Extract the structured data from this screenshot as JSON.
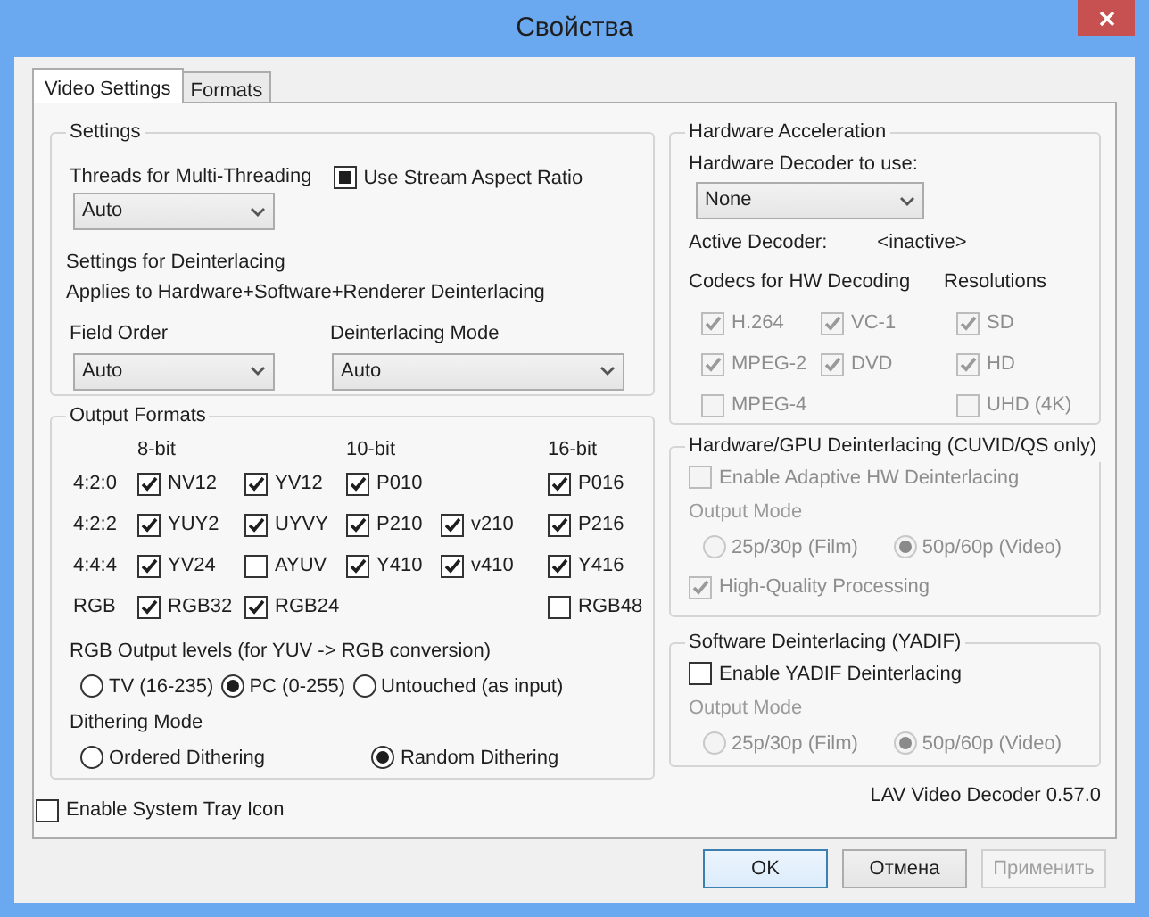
{
  "window": {
    "title": "Свойства"
  },
  "tabs": [
    {
      "label": "Video Settings",
      "selected": true
    },
    {
      "label": "Formats",
      "selected": false
    }
  ],
  "settings": {
    "title": "Settings",
    "threads": {
      "label": "Threads for Multi-Threading",
      "value": "Auto"
    },
    "stream_aspect_ratio": {
      "label": "Use Stream Aspect Ratio",
      "checked": false,
      "indeterminate": true
    },
    "deinterlacing_heading": "Settings for Deinterlacing",
    "deinterlacing_note": "Applies to Hardware+Software+Renderer Deinterlacing",
    "field_order": {
      "label": "Field Order",
      "value": "Auto"
    },
    "deinterlacing_mode": {
      "label": "Deinterlacing Mode",
      "value": "Auto"
    }
  },
  "output_formats": {
    "title": "Output Formats",
    "columns": {
      "bit_8": "8-bit",
      "bit_10": "10-bit",
      "bit_16": "16-bit"
    },
    "rows": [
      {
        "label": "4:2:0",
        "bit_8": [
          {
            "label": "NV12",
            "checked": true
          },
          {
            "label": "YV12",
            "checked": true
          }
        ],
        "bit_10": [
          {
            "label": "P010",
            "checked": true
          }
        ],
        "bit_16": [
          {
            "label": "P016",
            "checked": true
          }
        ]
      },
      {
        "label": "4:2:2",
        "bit_8": [
          {
            "label": "YUY2",
            "checked": true
          },
          {
            "label": "UYVY",
            "checked": true
          }
        ],
        "bit_10": [
          {
            "label": "P210",
            "checked": true
          },
          {
            "label": "v210",
            "checked": true
          }
        ],
        "bit_16": [
          {
            "label": "P216",
            "checked": true
          }
        ]
      },
      {
        "label": "4:4:4",
        "bit_8": [
          {
            "label": "YV24",
            "checked": true
          },
          {
            "label": "AYUV",
            "checked": false
          }
        ],
        "bit_10": [
          {
            "label": "Y410",
            "checked": true
          },
          {
            "label": "v410",
            "checked": true
          }
        ],
        "bit_16": [
          {
            "label": "Y416",
            "checked": true
          }
        ]
      },
      {
        "label": "RGB",
        "bit_8": [
          {
            "label": "RGB32",
            "checked": true
          },
          {
            "label": "RGB24",
            "checked": true
          }
        ],
        "bit_16": [
          {
            "label": "RGB48",
            "checked": false
          }
        ]
      }
    ],
    "rgb_levels": {
      "label": "RGB Output levels (for YUV -> RGB conversion)",
      "options": [
        {
          "label": "TV (16-235)",
          "selected": false
        },
        {
          "label": "PC (0-255)",
          "selected": true
        },
        {
          "label": "Untouched (as input)",
          "selected": false
        }
      ]
    },
    "dithering": {
      "label": "Dithering Mode",
      "options": [
        {
          "label": "Ordered Dithering",
          "selected": false
        },
        {
          "label": "Random Dithering",
          "selected": true
        }
      ]
    }
  },
  "system_tray": {
    "label": "Enable System Tray Icon",
    "checked": false
  },
  "hardware_acceleration": {
    "title": "Hardware Acceleration",
    "decoder_label": "Hardware Decoder to use:",
    "decoder": {
      "value": "None"
    },
    "active_decoder_label": "Active Decoder:",
    "active_decoder": "<inactive>",
    "codecs_label": "Codecs for HW Decoding",
    "resolutions_label": "Resolutions",
    "codecs": [
      {
        "label": "H.264",
        "checked": true,
        "disabled": true
      },
      {
        "label": "VC-1",
        "checked": true,
        "disabled": true
      },
      {
        "label": "MPEG-2",
        "checked": true,
        "disabled": true
      },
      {
        "label": "DVD",
        "checked": true,
        "disabled": true
      },
      {
        "label": "MPEG-4",
        "checked": false,
        "disabled": true
      }
    ],
    "resolutions": [
      {
        "label": "SD",
        "checked": true,
        "disabled": true
      },
      {
        "label": "HD",
        "checked": true,
        "disabled": true
      },
      {
        "label": "UHD (4K)",
        "checked": false,
        "disabled": true
      }
    ]
  },
  "hw_deinterlacing": {
    "title": "Hardware/GPU Deinterlacing (CUVID/QS only)",
    "adaptive": {
      "label": "Enable Adaptive HW Deinterlacing",
      "checked": false,
      "disabled": true
    },
    "output_mode": {
      "label": "Output Mode",
      "disabled": true,
      "options": [
        {
          "label": "25p/30p (Film)",
          "selected": false
        },
        {
          "label": "50p/60p (Video)",
          "selected": true
        }
      ]
    },
    "high_quality": {
      "label": "High-Quality Processing",
      "checked": true,
      "disabled": true
    }
  },
  "software_deinterlacing": {
    "title": "Software Deinterlacing (YADIF)",
    "enable": {
      "label": "Enable YADIF Deinterlacing",
      "checked": false,
      "disabled": false
    },
    "output_mode": {
      "label": "Output Mode",
      "disabled": true,
      "options": [
        {
          "label": "25p/30p (Film)",
          "selected": false
        },
        {
          "label": "50p/60p (Video)",
          "selected": true
        }
      ]
    }
  },
  "version": "LAV Video Decoder 0.57.0",
  "buttons": [
    {
      "label": "OK",
      "default": true,
      "disabled": false
    },
    {
      "label": "Отмена",
      "default": false,
      "disabled": false
    },
    {
      "label": "Применить",
      "default": false,
      "disabled": true
    }
  ]
}
